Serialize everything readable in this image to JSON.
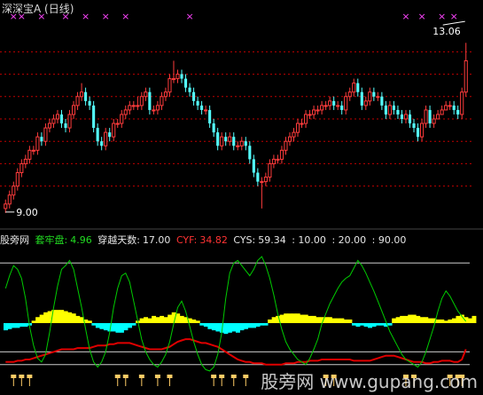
{
  "header": {
    "title": "深深宝A (日线)"
  },
  "indicator_bar": {
    "name": "股旁网",
    "fields": [
      {
        "label": "套牢盘:",
        "value": "4.96",
        "color": "#22dd22"
      },
      {
        "label": "穿越天数:",
        "value": "17.00",
        "color": "#e6e6e6"
      },
      {
        "label": "CYF:",
        "value": "34.82",
        "color": "#ff3333"
      },
      {
        "label": "CYS:",
        "value": "59.34",
        "color": "#e6e6e6"
      }
    ],
    "extra": [
      ": 10.00",
      ": 20.00",
      ": 90.00"
    ]
  },
  "watermark": "股旁网 www.gupang.com",
  "colors": {
    "background": "#000000",
    "up_candle": "#ff3c3c",
    "down_candle": "#54ffff",
    "gridline": "#c00000",
    "markers": "#ff44ff",
    "volume_pos": "#ffff00",
    "volume_neg": "#00ffff",
    "cyf_line": "#e00000",
    "cys_line": "#00cc00",
    "ref_line": "#cccccc",
    "signal_icon": "#ffcc66"
  },
  "chart_data": [
    {
      "type": "candlestick",
      "ylim": [
        8.7,
        13.3
      ],
      "annotations": [
        {
          "text": "13.06",
          "value": 13.06
        },
        {
          "text": "9.00",
          "value": 9.0
        }
      ],
      "close": [
        9.1,
        9.3,
        9.5,
        9.8,
        10.0,
        10.1,
        10.3,
        10.3,
        10.6,
        10.5,
        10.8,
        10.9,
        11.0,
        11.1,
        10.9,
        10.8,
        11.1,
        11.3,
        11.5,
        11.6,
        11.4,
        11.3,
        10.8,
        10.5,
        10.4,
        10.7,
        10.6,
        10.9,
        10.9,
        11.1,
        11.2,
        11.3,
        11.3,
        11.3,
        11.5,
        11.6,
        11.2,
        11.2,
        11.3,
        11.5,
        11.6,
        11.9,
        11.9,
        12.0,
        11.9,
        11.7,
        11.6,
        11.4,
        11.3,
        11.2,
        11.2,
        10.9,
        10.7,
        10.4,
        10.6,
        10.5,
        10.6,
        10.4,
        10.4,
        10.5,
        10.4,
        10.1,
        9.8,
        9.6,
        9.6,
        9.7,
        10.0,
        10.1,
        10.1,
        10.3,
        10.5,
        10.6,
        10.7,
        10.9,
        10.9,
        11.1,
        11.1,
        11.2,
        11.2,
        11.3,
        11.3,
        11.4,
        11.3,
        11.3,
        11.2,
        11.5,
        11.6,
        11.8,
        11.6,
        11.3,
        11.4,
        11.6,
        11.5,
        11.5,
        11.3,
        11.1,
        11.3,
        11.2,
        11.1,
        11.0,
        11.1,
        10.9,
        10.8,
        10.6,
        10.9,
        11.2,
        10.9,
        11.0,
        11.1,
        11.2,
        11.3,
        11.3,
        11.2,
        11.1,
        11.6,
        12.3
      ],
      "open": [
        9.0,
        9.1,
        9.3,
        9.5,
        9.8,
        10.0,
        10.1,
        10.3,
        10.3,
        10.6,
        10.5,
        10.8,
        10.9,
        11.0,
        11.1,
        10.9,
        10.8,
        11.1,
        11.3,
        11.5,
        11.6,
        11.4,
        11.3,
        10.8,
        10.5,
        10.4,
        10.7,
        10.6,
        10.9,
        10.9,
        11.1,
        11.2,
        11.3,
        11.3,
        11.3,
        11.5,
        11.6,
        11.2,
        11.2,
        11.3,
        11.5,
        11.6,
        11.9,
        11.9,
        12.0,
        11.9,
        11.7,
        11.6,
        11.4,
        11.3,
        11.2,
        11.2,
        10.9,
        10.7,
        10.4,
        10.6,
        10.5,
        10.6,
        10.4,
        10.4,
        10.5,
        10.4,
        10.1,
        9.8,
        9.6,
        9.6,
        9.7,
        10.0,
        10.1,
        10.1,
        10.3,
        10.5,
        10.6,
        10.7,
        10.9,
        10.9,
        11.1,
        11.1,
        11.2,
        11.2,
        11.3,
        11.3,
        11.4,
        11.3,
        11.3,
        11.2,
        11.5,
        11.6,
        11.8,
        11.6,
        11.3,
        11.4,
        11.6,
        11.5,
        11.5,
        11.3,
        11.1,
        11.3,
        11.2,
        11.1,
        11.0,
        11.1,
        10.9,
        10.8,
        10.6,
        10.9,
        11.2,
        10.9,
        11.0,
        11.1,
        11.2,
        11.3,
        11.3,
        11.2,
        11.1,
        11.6
      ],
      "high": [
        9.2,
        9.4,
        9.6,
        9.9,
        10.1,
        10.2,
        10.4,
        10.4,
        10.7,
        10.7,
        10.9,
        11.0,
        11.1,
        11.2,
        11.2,
        11.0,
        11.2,
        11.4,
        11.6,
        11.8,
        11.7,
        11.5,
        11.4,
        10.9,
        10.6,
        10.8,
        10.8,
        11.0,
        11.0,
        11.2,
        11.3,
        11.4,
        11.4,
        11.5,
        11.6,
        11.7,
        11.7,
        11.3,
        11.4,
        11.6,
        11.7,
        12.0,
        12.3,
        12.1,
        12.1,
        12.0,
        11.8,
        11.7,
        11.5,
        11.4,
        11.3,
        11.3,
        11.0,
        10.8,
        10.7,
        10.7,
        10.7,
        10.7,
        10.5,
        10.6,
        10.6,
        10.5,
        10.2,
        9.9,
        9.7,
        9.8,
        10.1,
        10.2,
        10.2,
        10.4,
        10.6,
        10.7,
        10.8,
        11.0,
        11.0,
        11.2,
        11.2,
        11.3,
        11.3,
        11.4,
        11.4,
        11.5,
        11.5,
        11.4,
        11.4,
        11.6,
        11.7,
        11.9,
        11.9,
        11.7,
        11.5,
        11.7,
        11.7,
        11.6,
        11.6,
        11.4,
        11.4,
        11.4,
        11.3,
        11.2,
        11.2,
        11.2,
        11.0,
        10.9,
        11.0,
        11.3,
        11.3,
        11.1,
        11.2,
        11.3,
        11.4,
        11.4,
        11.4,
        11.3,
        11.7,
        12.7
      ],
      "low": [
        8.9,
        9.0,
        9.2,
        9.4,
        9.7,
        9.9,
        10.0,
        10.2,
        10.2,
        10.4,
        10.4,
        10.7,
        10.8,
        10.9,
        10.8,
        10.7,
        10.7,
        11.0,
        11.2,
        11.4,
        11.3,
        11.2,
        10.7,
        10.4,
        10.3,
        10.3,
        10.5,
        10.5,
        10.8,
        10.8,
        11.0,
        11.1,
        11.2,
        11.2,
        11.2,
        11.4,
        11.1,
        11.1,
        11.1,
        11.2,
        11.4,
        11.5,
        11.8,
        11.8,
        11.8,
        11.6,
        11.5,
        11.3,
        11.2,
        11.1,
        11.1,
        10.8,
        10.6,
        10.3,
        10.3,
        10.4,
        10.4,
        10.3,
        10.3,
        10.3,
        10.3,
        10.0,
        9.7,
        9.5,
        9.0,
        9.5,
        9.6,
        9.9,
        10.0,
        10.0,
        10.2,
        10.4,
        10.5,
        10.6,
        10.8,
        10.8,
        11.0,
        11.0,
        11.1,
        11.1,
        11.2,
        11.2,
        11.2,
        11.2,
        11.1,
        11.1,
        11.4,
        11.5,
        11.5,
        11.2,
        11.2,
        11.3,
        11.4,
        11.4,
        11.2,
        11.0,
        11.0,
        11.1,
        11.0,
        10.9,
        10.9,
        10.8,
        10.7,
        10.5,
        10.5,
        10.8,
        10.8,
        10.8,
        11.0,
        11.1,
        11.2,
        11.2,
        11.1,
        11.0,
        11.0,
        11.5
      ],
      "markers_top": [
        2,
        4,
        9,
        15,
        20,
        25,
        30,
        46,
        100,
        104,
        109,
        112
      ]
    },
    {
      "type": "indicator",
      "ylim": [
        0,
        100
      ],
      "reference_lines": [
        90,
        20,
        10
      ],
      "series": [
        {
          "name": "CYF",
          "values": [
            12,
            12,
            12,
            13,
            13,
            14,
            14,
            15,
            16,
            17,
            18,
            19,
            20,
            21,
            22,
            22,
            22,
            22,
            23,
            23,
            23,
            23,
            24,
            25,
            25,
            25,
            26,
            26,
            27,
            27,
            27,
            27,
            26,
            25,
            24,
            23,
            22,
            22,
            22,
            22,
            23,
            24,
            26,
            28,
            29,
            30,
            30,
            29,
            28,
            27,
            27,
            26,
            25,
            24,
            22,
            20,
            18,
            16,
            14,
            13,
            12,
            12,
            11,
            11,
            11,
            10,
            10,
            10,
            10,
            10,
            11,
            11,
            11,
            12,
            12,
            12,
            13,
            13,
            13,
            14,
            14,
            14,
            14,
            14,
            14,
            14,
            14,
            13,
            13,
            13,
            13,
            13,
            14,
            15,
            16,
            17,
            17,
            17,
            16,
            15,
            14,
            13,
            12,
            12,
            12,
            11,
            11,
            12,
            12,
            13,
            13,
            13,
            12,
            12,
            14,
            22
          ]
        },
        {
          "name": "CYS",
          "values": [
            70,
            80,
            88,
            85,
            78,
            62,
            40,
            25,
            15,
            12,
            18,
            35,
            55,
            72,
            85,
            88,
            92,
            85,
            70,
            55,
            38,
            22,
            12,
            8,
            12,
            20,
            35,
            55,
            70,
            80,
            82,
            75,
            60,
            45,
            30,
            20,
            14,
            10,
            8,
            12,
            18,
            28,
            42,
            55,
            60,
            52,
            40,
            28,
            18,
            10,
            6,
            5,
            8,
            18,
            35,
            62,
            82,
            90,
            92,
            88,
            84,
            80,
            85,
            92,
            95,
            88,
            78,
            65,
            50,
            38,
            28,
            22,
            18,
            14,
            12,
            10,
            15,
            22,
            30,
            42,
            50,
            58,
            64,
            70,
            75,
            78,
            80,
            86,
            92,
            88,
            82,
            75,
            68,
            60,
            52,
            44,
            36,
            30,
            24,
            18,
            14,
            12,
            10,
            8,
            12,
            20,
            30,
            40,
            52,
            62,
            68,
            64,
            58,
            52,
            48,
            44
          ]
        }
      ],
      "histogram": [
        -6,
        -5,
        -4,
        -4,
        -3,
        -3,
        -2,
        2,
        5,
        7,
        9,
        10,
        11,
        11,
        11,
        10,
        9,
        8,
        6,
        5,
        3,
        2,
        -2,
        -4,
        -5,
        -6,
        -7,
        -7,
        -8,
        -8,
        -6,
        -4,
        -2,
        2,
        4,
        5,
        4,
        6,
        5,
        6,
        5,
        7,
        9,
        8,
        6,
        5,
        4,
        3,
        2,
        -2,
        -3,
        -5,
        -6,
        -7,
        -8,
        -9,
        -8,
        -7,
        -8,
        -6,
        -5,
        -4,
        -4,
        -3,
        -2,
        -2,
        3,
        5,
        6,
        7,
        8,
        8,
        8,
        8,
        7,
        7,
        6,
        6,
        5,
        5,
        5,
        5,
        4,
        4,
        4,
        3,
        3,
        -2,
        -3,
        -2,
        -3,
        -4,
        -3,
        -2,
        -2,
        -3,
        -2,
        4,
        5,
        6,
        6,
        7,
        7,
        6,
        5,
        5,
        4,
        4,
        3,
        3,
        2,
        3,
        4,
        6,
        7,
        5,
        4,
        6
      ],
      "signals": [
        2,
        4,
        6,
        28,
        30,
        34,
        38,
        41,
        52,
        54,
        57,
        60,
        80,
        82,
        100,
        102,
        111,
        113,
        114
      ]
    }
  ]
}
